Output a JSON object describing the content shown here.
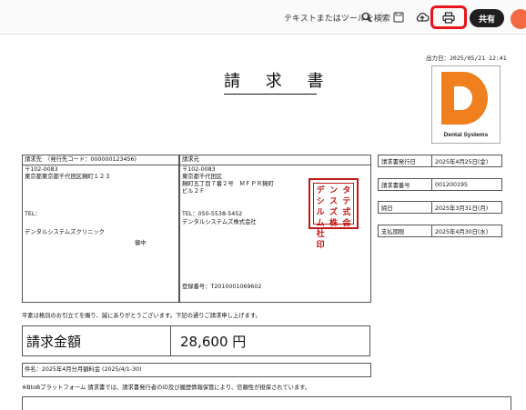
{
  "toolbar": {
    "search_label": "テキストまたはツールを検索",
    "share_label": "共有"
  },
  "document": {
    "title": "請 求 書",
    "output_date": "出力日：2025/05/21 12:41",
    "logo_text": "Dental Systems",
    "billed_to": {
      "header": "請求先　（発行先コード：000000123456)",
      "postal": "〒102-0083",
      "address": "東京都東京都千代田区麹町１２３",
      "tel": "TEL：",
      "name": "デンタルシステムズクリニック",
      "honorific": "御中"
    },
    "issuer": {
      "header": "請求元",
      "postal": "〒102-0083",
      "address1": "東京都千代田区",
      "address2": "麹町五丁目７番２号　ＭＦＰＲ麹町",
      "address3": "ビル２Ｆ",
      "tel": "TEL：050-5538-5452",
      "name": "デンタルシステムズ株式会社",
      "registration": "登録番号：T2010001069602",
      "seal_text": [
        "デシ",
        "ンス",
        "タテ",
        "ルム",
        "ズ株",
        "式会",
        "社印"
      ]
    },
    "info": [
      {
        "label": "請求書発行日",
        "value": "2025年4月25日(金)"
      },
      {
        "label": "請求書番号",
        "value": "001200195"
      },
      {
        "label": "締日",
        "value": "2025年3月31日(月)"
      },
      {
        "label": "支払期限",
        "value": "2025年4月30日(水)"
      }
    ],
    "greeting": "平素は格別のお引立てを賜り、誠にありがとうございます。下記の通りご請求申し上げます。",
    "amount_label": "請求金額",
    "amount_value": "28,600 円",
    "subject": "件名：2025年4月分月額料金 (2025/4/1-30)",
    "footnote": "※BtoBプラットフォーム 請求書では、請求書発行者のID及び履歴情報保管により、信頼性が担保されています。"
  }
}
